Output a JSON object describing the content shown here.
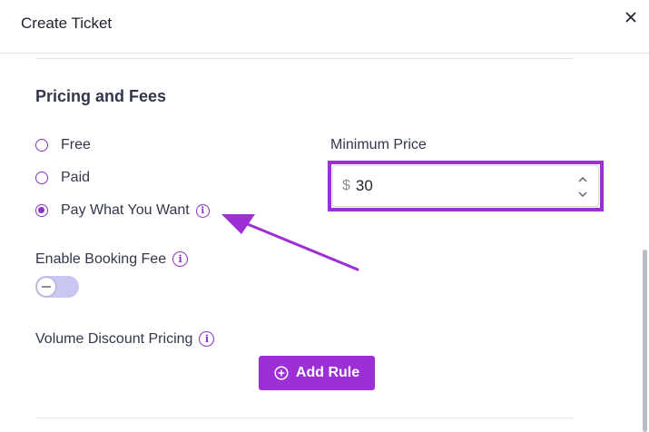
{
  "header": {
    "title": "Create Ticket",
    "close_icon": "close-icon"
  },
  "pricing": {
    "section_title": "Pricing and Fees",
    "options": [
      {
        "label": "Free",
        "selected": false
      },
      {
        "label": "Paid",
        "selected": false
      },
      {
        "label": "Pay What You Want",
        "selected": true
      }
    ]
  },
  "minimum_price": {
    "label": "Minimum Price",
    "currency": "$",
    "value": "30"
  },
  "booking_fee": {
    "label": "Enable Booking Fee",
    "enabled": false
  },
  "volume_discount": {
    "label": "Volume Discount Pricing",
    "add_rule_label": "Add Rule"
  },
  "colors": {
    "accent": "#9c2fd6",
    "radio": "#8a32c8",
    "toggle_off": "#c9c6ef"
  }
}
